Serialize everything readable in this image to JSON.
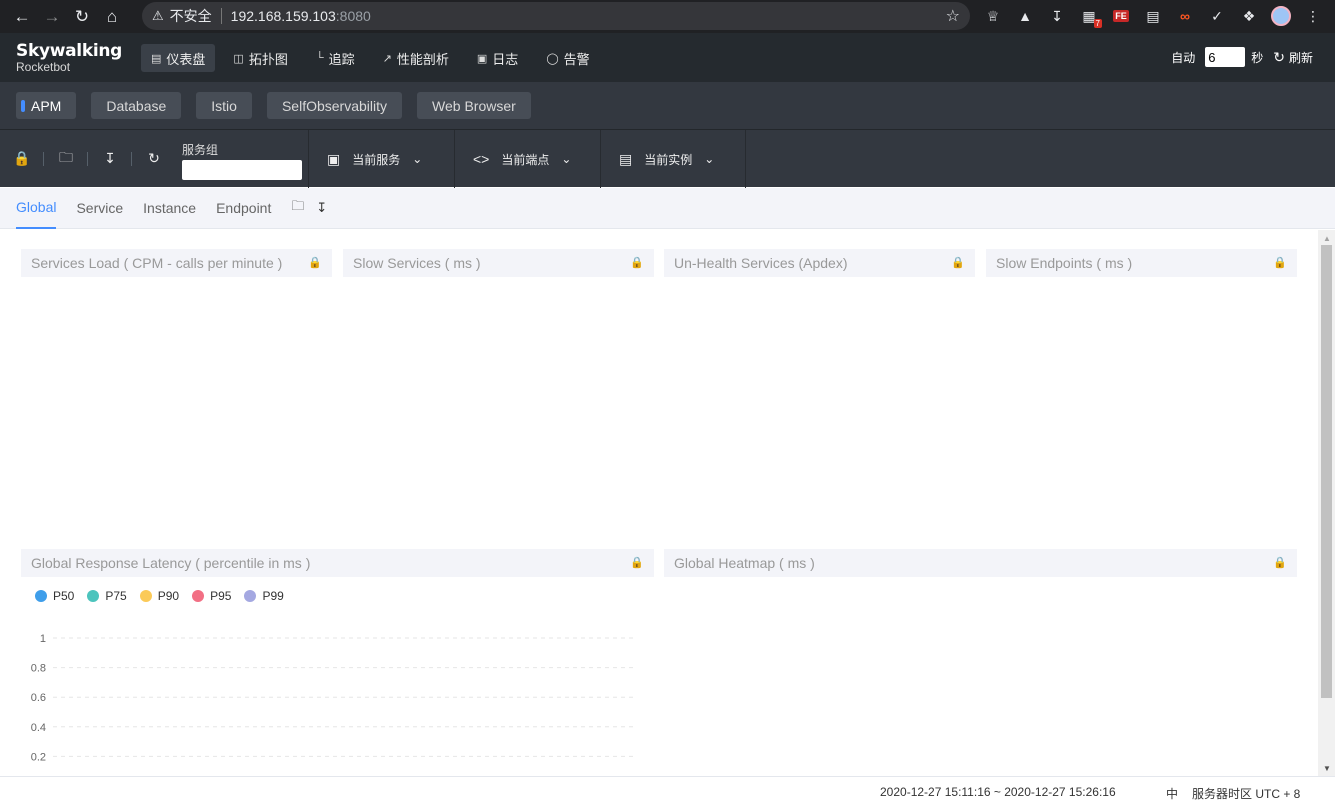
{
  "browser": {
    "security_label": "不安全",
    "url_host": "192.168.159.103",
    "url_port": ":8080",
    "ext_badge": "7",
    "ext_fe": "FE"
  },
  "header": {
    "logo_title": "Skywalking",
    "logo_subtitle": "Rocketbot",
    "nav": [
      {
        "label": "仪表盘",
        "active": true
      },
      {
        "label": "拓扑图"
      },
      {
        "label": "追踪"
      },
      {
        "label": "性能剖析"
      },
      {
        "label": "日志"
      },
      {
        "label": "告警"
      }
    ],
    "auto_label": "自动",
    "interval_value": "6",
    "seconds_label": "秒",
    "refresh_label": "刷新"
  },
  "layers": [
    "APM",
    "Database",
    "Istio",
    "SelfObservability",
    "Web Browser"
  ],
  "toolbar": {
    "group_label": "服务组",
    "group_value": "",
    "service_label": "当前服务",
    "endpoint_label": "当前端点",
    "instance_label": "当前实例"
  },
  "dashboard_tabs": [
    "Global",
    "Service",
    "Instance",
    "Endpoint"
  ],
  "panels": {
    "services_load": "Services Load ( CPM - calls per minute )",
    "slow_services": "Slow Services ( ms )",
    "unhealth_services": "Un-Health Services (Apdex)",
    "slow_endpoints": "Slow Endpoints ( ms )",
    "global_latency": "Global Response Latency ( percentile in ms )",
    "global_heatmap": "Global Heatmap ( ms )"
  },
  "chart_data": {
    "type": "line",
    "legend_position": "top-left",
    "series": [
      {
        "name": "P50",
        "color": "#3f9eea",
        "values": []
      },
      {
        "name": "P75",
        "color": "#4cc4bd",
        "values": []
      },
      {
        "name": "P90",
        "color": "#fbca58",
        "values": []
      },
      {
        "name": "P95",
        "color": "#f26f84",
        "values": []
      },
      {
        "name": "P99",
        "color": "#a4a8e1",
        "values": []
      }
    ],
    "y_ticks": [
      "1",
      "0.8",
      "0.6",
      "0.4",
      "0.2"
    ],
    "ylim": [
      0,
      1
    ],
    "grid": true
  },
  "footer": {
    "time_range": "2020-12-27 15:11:16 ~ 2020-12-27 15:26:16",
    "language": "中",
    "timezone": "服务器时区 UTC + 8"
  }
}
